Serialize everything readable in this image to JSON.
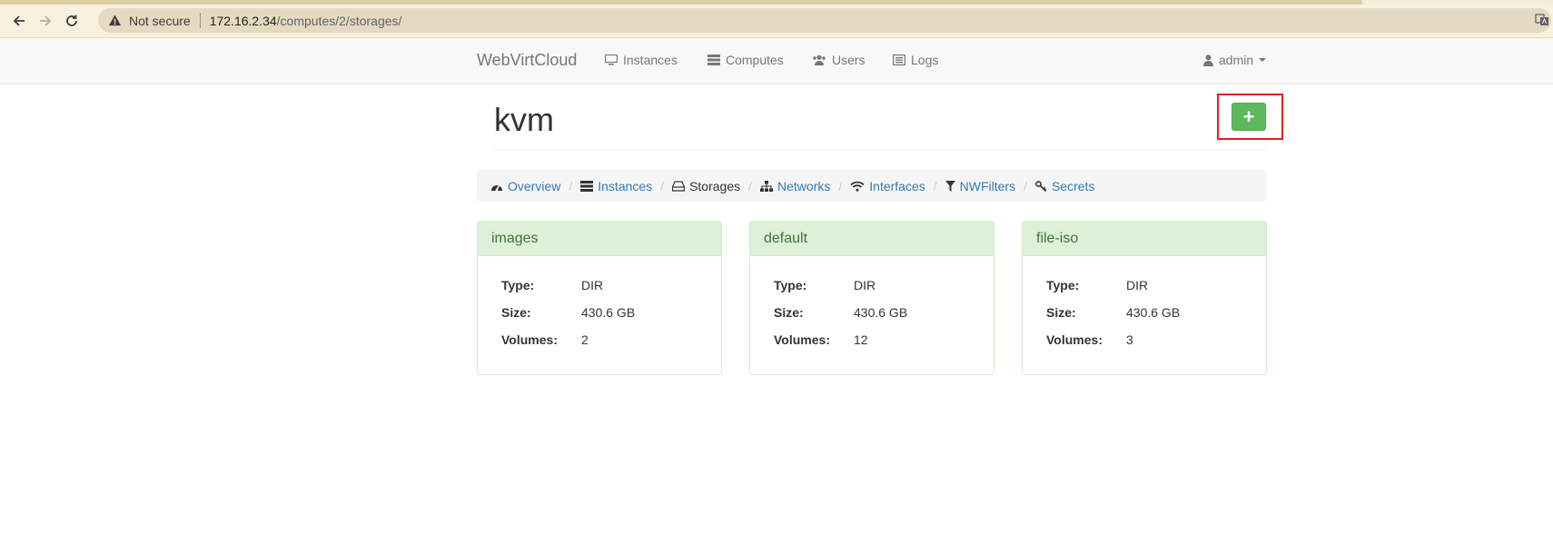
{
  "browser": {
    "security_label": "Not secure",
    "url_host": "172.16.2.34",
    "url_path": "/computes/2/storages/"
  },
  "navbar": {
    "brand": "WebVirtCloud",
    "links": [
      {
        "label": "Instances",
        "icon": "desktop-icon"
      },
      {
        "label": "Computes",
        "icon": "server-icon"
      },
      {
        "label": "Users",
        "icon": "users-icon"
      },
      {
        "label": "Logs",
        "icon": "list-alt-icon"
      }
    ],
    "user": "admin"
  },
  "page": {
    "title": "kvm",
    "add_button_label": "+"
  },
  "breadcrumb": [
    {
      "label": "Overview",
      "icon": "dashboard-icon",
      "active": false
    },
    {
      "label": "Instances",
      "icon": "server-icon",
      "active": false
    },
    {
      "label": "Storages",
      "icon": "hdd-icon",
      "active": true
    },
    {
      "label": "Networks",
      "icon": "sitemap-icon",
      "active": false
    },
    {
      "label": "Interfaces",
      "icon": "wifi-icon",
      "active": false
    },
    {
      "label": "NWFilters",
      "icon": "filter-icon",
      "active": false
    },
    {
      "label": "Secrets",
      "icon": "key-icon",
      "active": false
    }
  ],
  "storages": [
    {
      "name": "images",
      "type_label": "Type:",
      "type": "DIR",
      "size_label": "Size:",
      "size": "430.6 GB",
      "volumes_label": "Volumes:",
      "volumes": "2"
    },
    {
      "name": "default",
      "type_label": "Type:",
      "type": "DIR",
      "size_label": "Size:",
      "size": "430.6 GB",
      "volumes_label": "Volumes:",
      "volumes": "12"
    },
    {
      "name": "file-iso",
      "type_label": "Type:",
      "type": "DIR",
      "size_label": "Size:",
      "size": "430.6 GB",
      "volumes_label": "Volumes:",
      "volumes": "3"
    }
  ],
  "colors": {
    "link": "#337ab7",
    "success": "#5cb85c",
    "panel_heading_bg": "#dff0d8",
    "panel_heading_text": "#3c763d",
    "highlight": "#e02020"
  }
}
